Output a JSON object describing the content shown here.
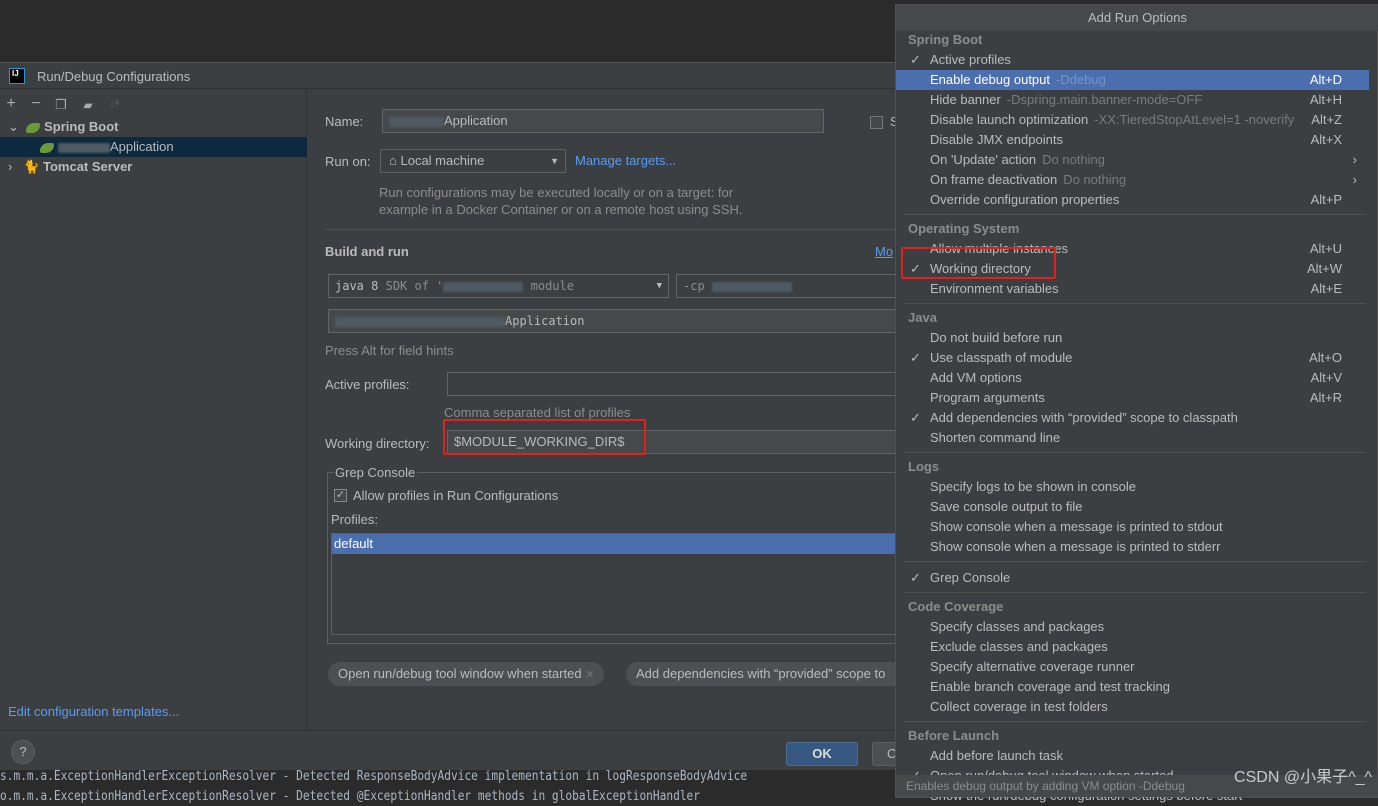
{
  "dialog": {
    "title": "Run/Debug Configurations",
    "toolbar_icons": [
      "add-icon",
      "remove-icon",
      "copy-icon",
      "folder-add-icon",
      "sort-icon"
    ],
    "tree": [
      {
        "label": "Spring Boot",
        "expanded": true
      },
      {
        "label": "Application",
        "selected": true
      },
      {
        "label": "Tomcat Server",
        "expanded": false
      }
    ],
    "edit_templates": "Edit configuration templates...",
    "name_label": "Name:",
    "name_value": "Application",
    "store_checkbox_label": "S",
    "run_on_label": "Run on:",
    "run_on_value": "Local machine",
    "manage_targets": "Manage targets...",
    "run_on_hint_1": "Run configurations may be executed locally or on a target: for",
    "run_on_hint_2": "example in a Docker Container or on a remote host using SSH.",
    "build_and_run": "Build and run",
    "modify_options": "Mo",
    "jre_value": "java 8",
    "jre_hint": "SDK of '",
    "jre_module": "module",
    "classpath_value": "-cp",
    "main_class": "Application",
    "field_hints": "Press Alt for field hints",
    "active_profiles_label": "Active profiles:",
    "active_profiles_value": "",
    "active_profiles_hint": "Comma separated list of profiles",
    "working_dir_label": "Working directory:",
    "working_dir_value": "$MODULE_WORKING_DIR$",
    "grep_console": {
      "title": "Grep Console",
      "allow_profiles": "Allow profiles in Run Configurations",
      "allow_profiles_checked": true,
      "profiles_label": "Profiles:",
      "profiles": [
        "default"
      ]
    },
    "chips": [
      "Open run/debug tool window when started",
      "Add dependencies with “provided” scope to"
    ],
    "ok": "OK",
    "cancel": "C",
    "help": "?"
  },
  "console": [
    "s.m.m.a.ExceptionHandlerExceptionResolver - Detected ResponseBodyAdvice implementation in logResponseBodyAdvice",
    "o.m.m.a.ExceptionHandlerExceptionResolver - Detected @ExceptionHandler methods in globalExceptionHandler"
  ],
  "menu": {
    "title": "Add Run Options",
    "sections": [
      {
        "header": "Spring Boot",
        "items": [
          {
            "label": "Active profiles",
            "checked": true
          },
          {
            "label": "Enable debug output",
            "sub": "-Ddebug",
            "shortcut": "Alt+D",
            "selected": true
          },
          {
            "label": "Hide banner",
            "sub": "-Dspring.main.banner-mode=OFF",
            "shortcut": "Alt+H"
          },
          {
            "label": "Disable launch optimization",
            "sub": "-XX:TieredStopAtLevel=1 -noverify",
            "shortcut": "Alt+Z"
          },
          {
            "label": "Disable JMX endpoints",
            "shortcut": "Alt+X"
          },
          {
            "label": "On 'Update' action",
            "sub": "Do nothing",
            "submenu": true
          },
          {
            "label": "On frame deactivation",
            "sub": "Do nothing",
            "submenu": true
          },
          {
            "label": "Override configuration properties",
            "shortcut": "Alt+P"
          }
        ]
      },
      {
        "header": "Operating System",
        "items": [
          {
            "label": "Allow multiple instances",
            "shortcut": "Alt+U"
          },
          {
            "label": "Working directory",
            "checked": true,
            "shortcut": "Alt+W",
            "highlighted": true
          },
          {
            "label": "Environment variables",
            "shortcut": "Alt+E"
          }
        ]
      },
      {
        "header": "Java",
        "items": [
          {
            "label": "Do not build before run"
          },
          {
            "label": "Use classpath of module",
            "checked": true,
            "shortcut": "Alt+O"
          },
          {
            "label": "Add VM options",
            "shortcut": "Alt+V"
          },
          {
            "label": "Program arguments",
            "shortcut": "Alt+R"
          },
          {
            "label": "Add dependencies with “provided” scope to classpath",
            "checked": true
          },
          {
            "label": "Shorten command line"
          }
        ]
      },
      {
        "header": "Logs",
        "items": [
          {
            "label": "Specify logs to be shown in console"
          },
          {
            "label": "Save console output to file"
          },
          {
            "label": "Show console when a message is printed to stdout"
          },
          {
            "label": "Show console when a message is printed to stderr"
          }
        ]
      },
      {
        "header": "",
        "items": [
          {
            "label": "Grep Console",
            "checked": true
          }
        ]
      },
      {
        "header": "Code Coverage",
        "items": [
          {
            "label": "Specify classes and packages"
          },
          {
            "label": "Exclude classes and packages"
          },
          {
            "label": "Specify alternative coverage runner"
          },
          {
            "label": "Enable branch coverage and test tracking"
          },
          {
            "label": "Collect coverage in test folders"
          }
        ]
      },
      {
        "header": "Before Launch",
        "items": [
          {
            "label": "Add before launch task"
          },
          {
            "label": "Open run/debug tool window when started",
            "checked": true
          },
          {
            "label": "Show the run/debug configuration settings before start"
          }
        ]
      }
    ],
    "status": "Enables debug output by adding VM option -Ddebug"
  },
  "watermark": "CSDN @小果子^_^",
  "colors": {
    "accent": "#4b6eaf",
    "highlight_box": "#e3201b",
    "link": "#589df6",
    "ok_button": "#365880"
  }
}
